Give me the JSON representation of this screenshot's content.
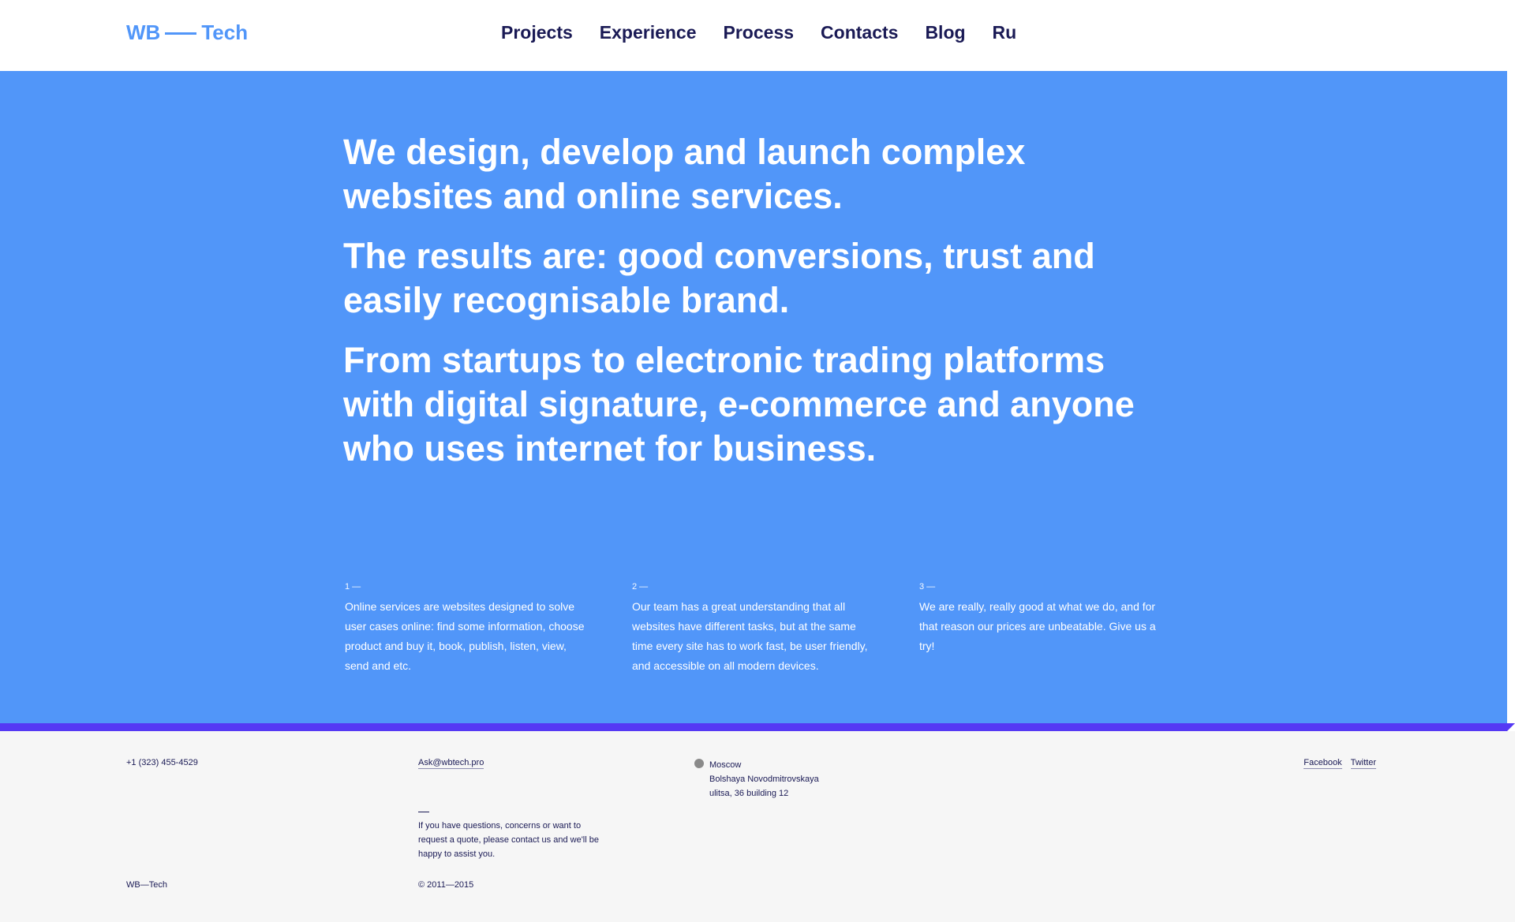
{
  "header": {
    "logo_left": "WB",
    "logo_right": "Tech",
    "nav": [
      {
        "label": "Projects"
      },
      {
        "label": "Experience"
      },
      {
        "label": "Process"
      },
      {
        "label": "Contacts"
      },
      {
        "label": "Blog"
      },
      {
        "label": "Ru"
      }
    ]
  },
  "hero": {
    "statements": [
      "We design, develop and launch complex websites and online services.",
      "The results are: good conversions, trust and easily recognisable brand.",
      "From startups to electronic trading platforms with digital signature, e-commerce and anyone who uses internet for business."
    ],
    "points": [
      {
        "num": "1 —",
        "text": "Online services are websites designed to solve user cases online: find some information, choose product and buy it, book, publish, listen, view, send and etc."
      },
      {
        "num": "2 —",
        "text": "Our team has a great understanding that all websites have different tasks, but at the same time every site has to work fast, be user friendly, and accessible on all modern devices."
      },
      {
        "num": "3 —",
        "text": "We are really, really good at what we do, and for that reason our prices are unbeatable. Give us a try!"
      }
    ]
  },
  "footer": {
    "phone": "+1 (323) 455-4529",
    "email": "Ask@wbtech.pro",
    "address": [
      "Moscow",
      "Bolshaya Novodmitrovskaya",
      "ulitsa, 36 building 12"
    ],
    "social": [
      {
        "label": "Facebook"
      },
      {
        "label": "Twitter"
      }
    ],
    "note_dash": "—",
    "note": "If you have questions, concerns or want to request a quote, please contact us and we'll be happy to assist you.",
    "brand": "WB—Tech",
    "copyright": "© 2011—2015"
  },
  "colors": {
    "accent_blue": "#5196f9",
    "bar_violet": "#5539f4",
    "text_navy": "#1a1a55",
    "footer_bg": "#f6f6f6"
  }
}
